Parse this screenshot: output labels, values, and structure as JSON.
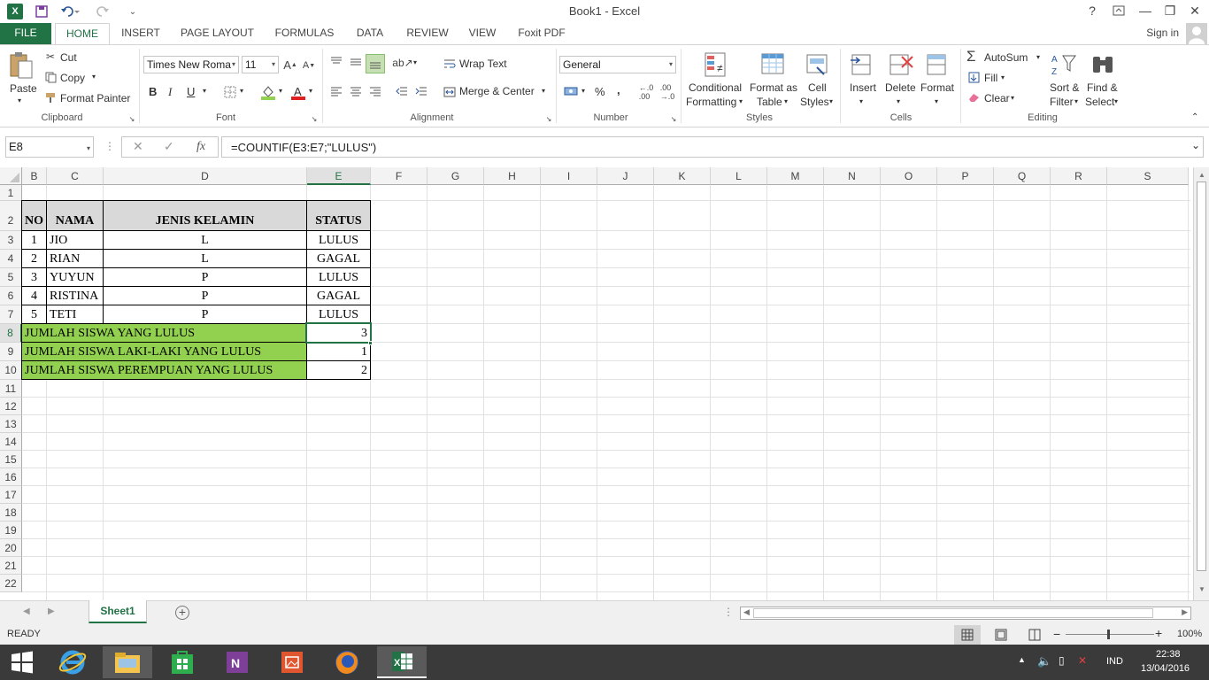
{
  "window": {
    "title": "Book1 - Excel",
    "help": "?",
    "logo_letter": "X"
  },
  "tabs": [
    "FILE",
    "HOME",
    "INSERT",
    "PAGE LAYOUT",
    "FORMULAS",
    "DATA",
    "REVIEW",
    "VIEW",
    "Foxit PDF"
  ],
  "sign_in": "Sign in",
  "clipboard": {
    "paste": "Paste",
    "cut": "Cut",
    "copy": "Copy",
    "format_painter": "Format Painter",
    "label": "Clipboard"
  },
  "font": {
    "family": "Times New Roma",
    "size": "11",
    "bold": "B",
    "italic": "I",
    "underline": "U",
    "label": "Font"
  },
  "alignment": {
    "wrap_text": "Wrap Text",
    "merge_center": "Merge & Center",
    "label": "Alignment"
  },
  "number": {
    "format": "General",
    "percent": "%",
    "comma": ",",
    "label": "Number"
  },
  "styles": {
    "conditional_formatting": [
      "Conditional",
      "Formatting"
    ],
    "format_as_table": [
      "Format as",
      "Table"
    ],
    "cell_styles": [
      "Cell",
      "Styles"
    ],
    "label": "Styles"
  },
  "cells": {
    "insert": "Insert",
    "delete": "Delete",
    "format": "Format",
    "label": "Cells"
  },
  "editing": {
    "autosum": "AutoSum",
    "fill": "Fill",
    "clear": "Clear",
    "sort_filter": [
      "Sort &",
      "Filter"
    ],
    "find_select": [
      "Find &",
      "Select"
    ],
    "label": "Editing"
  },
  "formula_bar": {
    "name_box": "E8",
    "fx": "fx",
    "formula": "=COUNTIF(E3:E7;\"LULUS\")"
  },
  "columns": [
    "B",
    "C",
    "D",
    "E",
    "F",
    "G",
    "H",
    "I",
    "J",
    "K",
    "L",
    "M",
    "N",
    "O",
    "P",
    "Q",
    "R",
    "S"
  ],
  "rows": [
    "1",
    "2",
    "3",
    "4",
    "5",
    "6",
    "7",
    "8",
    "9",
    "10",
    "11",
    "12",
    "13",
    "14",
    "15",
    "16",
    "17",
    "18",
    "19",
    "20",
    "21",
    "22"
  ],
  "table": {
    "headers": [
      "NO",
      "NAMA",
      "JENIS KELAMIN",
      "STATUS"
    ],
    "rows": [
      [
        "1",
        "JIO",
        "L",
        "LULUS"
      ],
      [
        "2",
        "RIAN",
        "L",
        "GAGAL"
      ],
      [
        "3",
        "YUYUN",
        "P",
        "LULUS"
      ],
      [
        "4",
        "RISTINA",
        "P",
        "GAGAL"
      ],
      [
        "5",
        "TETI",
        "P",
        "LULUS"
      ]
    ],
    "summary": [
      {
        "label": "JUMLAH SISWA YANG LULUS",
        "value": "3"
      },
      {
        "label": "JUMLAH SISWA LAKI-LAKI YANG LULUS",
        "value": "1"
      },
      {
        "label": "JUMLAH SISWA PEREMPUAN YANG LULUS",
        "value": "2"
      }
    ],
    "summary_color": "#92d050",
    "header_color": "#d9d9d9"
  },
  "sheet_tab": "Sheet1",
  "status": {
    "ready": "READY",
    "zoom": "100%"
  },
  "taskbar": {
    "language": "IND",
    "time": "22:38",
    "date": "13/04/2016"
  },
  "accent": "#217346"
}
